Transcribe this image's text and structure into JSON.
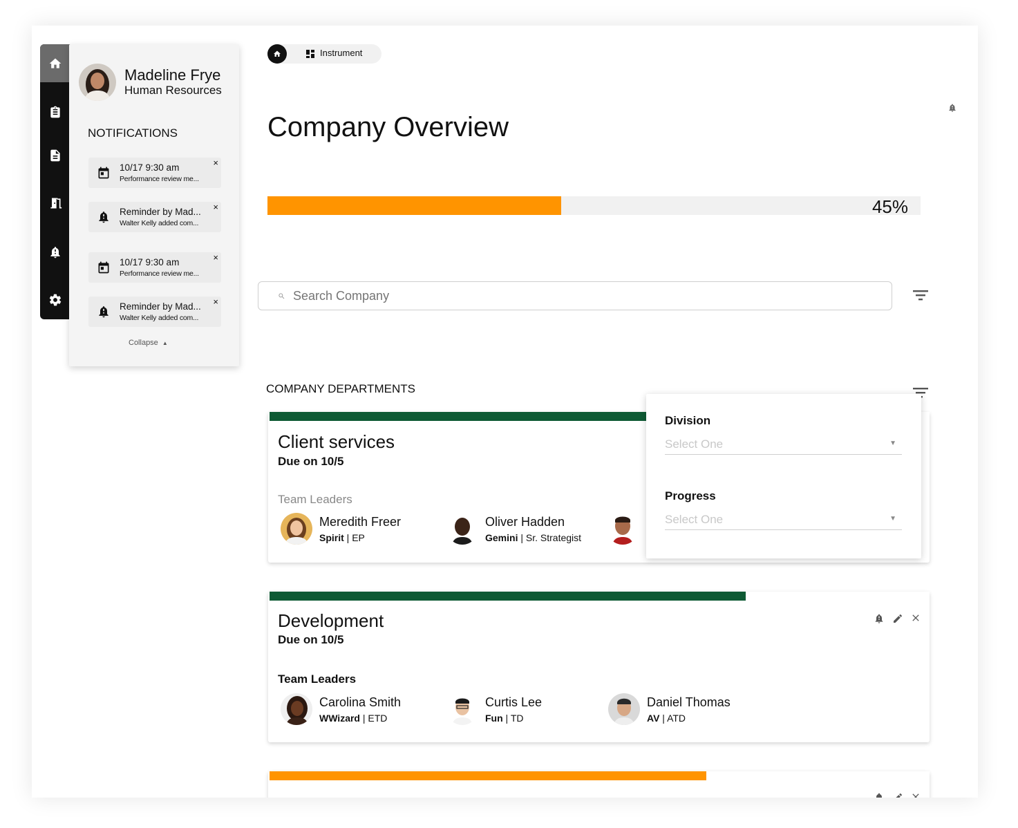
{
  "user": {
    "name": "Madeline Frye",
    "role": "Human Resources"
  },
  "notifications": {
    "heading": "NOTIFICATIONS",
    "items": [
      {
        "icon": "calendar-icon",
        "title": "10/17 9:30 am",
        "text": "Performance review me..."
      },
      {
        "icon": "bell-icon",
        "title": "Reminder by Mad...",
        "text": "Walter Kelly added com..."
      },
      {
        "icon": "calendar-icon",
        "title": "10/17 9:30 am",
        "text": "Performance review me..."
      },
      {
        "icon": "bell-icon",
        "title": "Reminder by Mad...",
        "text": "Walter Kelly added com..."
      }
    ],
    "collapse_label": "Collapse",
    "close_glyph": "×"
  },
  "sidebar": {
    "icons": [
      "home-icon",
      "clipboard-icon",
      "document-icon",
      "exit-icon",
      "alert-bell-icon",
      "gear-icon"
    ]
  },
  "breadcrumb": {
    "label": "Instrument"
  },
  "page": {
    "title": "Company Overview",
    "progress_label": "45%",
    "progress": 0.45
  },
  "search": {
    "placeholder": "Search Company"
  },
  "departments": {
    "heading": "COMPANY DEPARTMENTS",
    "cards": [
      {
        "title": "Client services",
        "due": "Due on 10/5",
        "leaders_label": "Team Leaders",
        "progress": 0.57,
        "bar_color": "#0e5a34",
        "leaders": [
          {
            "name": "Meredith Freer",
            "team": "Spirit",
            "role": "EP"
          },
          {
            "name": "Oliver Hadden",
            "team": "Gemini",
            "role": "Sr. Strategist"
          }
        ]
      },
      {
        "title": "Development",
        "due": "Due on 10/5",
        "leaders_label": "Team Leaders",
        "progress": 0.72,
        "bar_color": "#0e5a34",
        "leaders": [
          {
            "name": "Carolina Smith",
            "team": "WWizard",
            "role": "ETD"
          },
          {
            "name": "Curtis Lee",
            "team": "Fun",
            "role": "TD"
          },
          {
            "name": "Daniel Thomas",
            "team": "AV",
            "role": "ATD"
          }
        ]
      },
      {
        "progress": 0.66,
        "bar_color": "#ff9400"
      }
    ]
  },
  "filter_panel": {
    "division_label": "Division",
    "division_placeholder": "Select One",
    "progress_label": "Progress",
    "progress_placeholder": "Select One"
  },
  "colors": {
    "accent": "#ff9400",
    "green": "#0e5a34",
    "sidebar": "#111111"
  }
}
